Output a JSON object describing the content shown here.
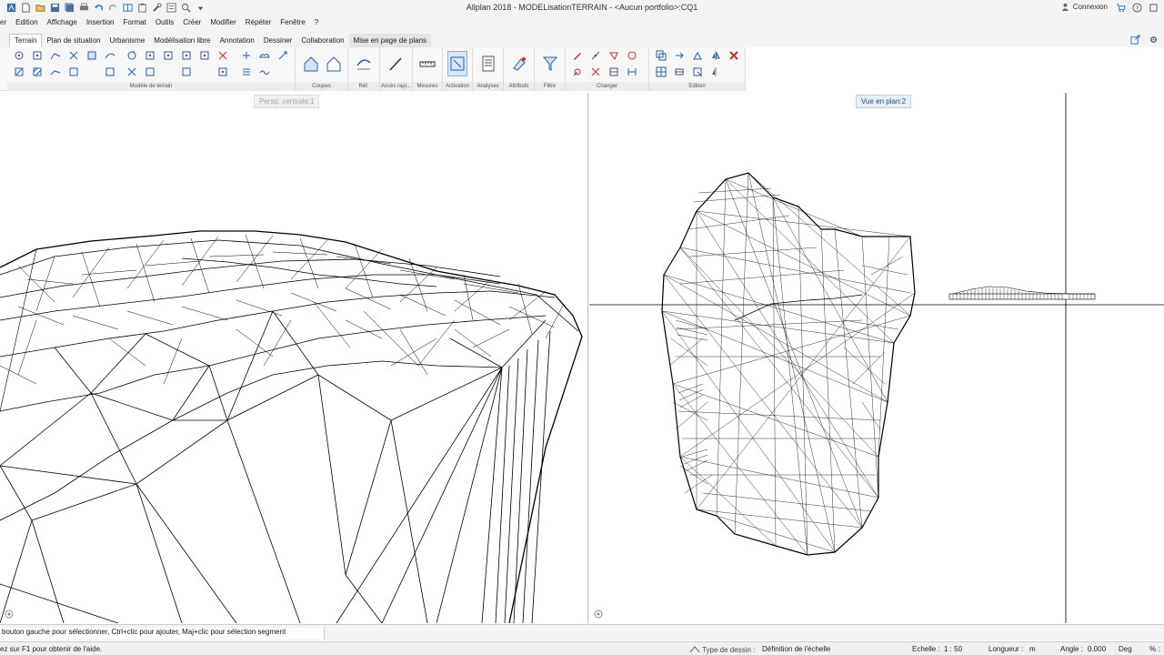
{
  "titlebar": {
    "title": "Allplan 2018 - MODELisationTERRAIN - <Aucun portfolio>:CQ1",
    "connexion_label": "Connexion",
    "quick_access_icons": [
      "allplan-app-icon",
      "new-file-icon",
      "open-folder-icon",
      "save-icon",
      "save-all-icon",
      "print-icon",
      "undo-icon",
      "redo-icon",
      "layout-icon",
      "clipboard-icon",
      "tools-icon",
      "properties-icon",
      "zoom-icon",
      "qat-menu-icon"
    ]
  },
  "menubar": {
    "items": [
      "er",
      "Edition",
      "Affichage",
      "Insertion",
      "Format",
      "Outils",
      "Créer",
      "Modifier",
      "Répéter",
      "Fenêtre",
      "?"
    ]
  },
  "tabs": {
    "items": [
      "Terrain",
      "Plan de situation",
      "Urbanisme",
      "Modélisation libre",
      "Annotation",
      "Dessiner",
      "Collaboration",
      "Mise en page de plans"
    ],
    "active": "Terrain"
  },
  "ribbon": {
    "groups": [
      {
        "label": "Modèle de terrain"
      },
      {
        "label": "Coupes"
      },
      {
        "label": "Réf."
      },
      {
        "label": "Accès rapi..."
      },
      {
        "label": "Mesures"
      },
      {
        "label": "Activation"
      },
      {
        "label": "Analyses"
      },
      {
        "label": "Attributs"
      },
      {
        "label": "Filtre"
      },
      {
        "label": "Changer"
      },
      {
        "label": "Edition"
      }
    ]
  },
  "viewports": {
    "left_label": "Persp. centrale:1",
    "right_label": "Vue en plan:2"
  },
  "hint": {
    "text": "bouton gauche pour sélectionner, Ctrl+clic pour ajouter, Maj+clic pour sélection segment"
  },
  "statusbar": {
    "help_text": "ez sur F1 pour obtenir de l'aide.",
    "drawing_type_label": "Type de dessin :",
    "drawing_type_value": "Définition de l'échelle",
    "scale_label": "Echelle :",
    "scale_value": "1 : 50",
    "length_label": "Longueur :",
    "length_value": "m",
    "angle_label": "Angle :",
    "angle_value": "0.000",
    "angle_unit": "Deg",
    "percent_label": "% :"
  },
  "colors": {
    "accent": "#2a4c78",
    "axis_red": "#c00000",
    "axis_green": "#00a000",
    "path_purple": "#8a3fb0"
  }
}
